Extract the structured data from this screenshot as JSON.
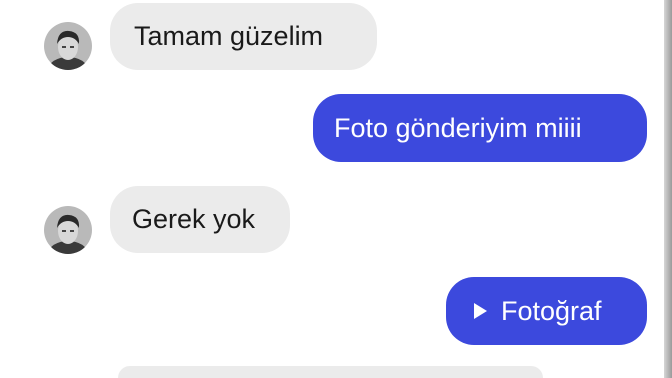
{
  "conversation": {
    "messages": [
      {
        "direction": "incoming",
        "text": "Tamam güzelim"
      },
      {
        "direction": "outgoing",
        "text": "Foto gönderiyim miiii"
      },
      {
        "direction": "incoming",
        "text": "Gerek yok"
      },
      {
        "direction": "outgoing",
        "type": "photo",
        "icon": "play-icon",
        "text": "Fotoğraf"
      },
      {
        "direction": "incoming",
        "text": ""
      }
    ]
  },
  "colors": {
    "outgoing_bubble": "#3c49dd",
    "incoming_bubble": "#ebebeb",
    "background": "#ffffff"
  }
}
